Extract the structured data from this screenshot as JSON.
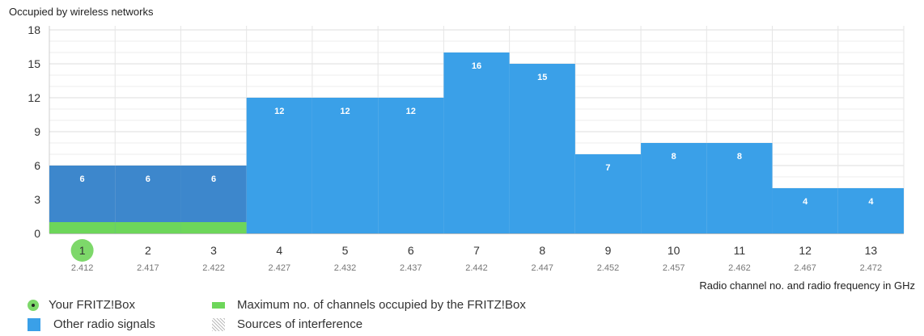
{
  "chart_data": {
    "type": "bar",
    "title": "Occupied by wireless networks",
    "xlabel": "Radio channel no. and radio frequency in GHz",
    "ylabel": "",
    "ylim": [
      0,
      18
    ],
    "yticks": [
      0,
      3,
      6,
      9,
      12,
      15,
      18
    ],
    "grid": true,
    "categories": [
      "1",
      "2",
      "3",
      "4",
      "5",
      "6",
      "7",
      "8",
      "9",
      "10",
      "11",
      "12",
      "13"
    ],
    "frequencies": [
      "2.412",
      "2.417",
      "2.422",
      "2.427",
      "2.432",
      "2.437",
      "2.442",
      "2.447",
      "2.452",
      "2.457",
      "2.462",
      "2.467",
      "2.472"
    ],
    "values": [
      6,
      6,
      6,
      12,
      12,
      12,
      16,
      15,
      7,
      8,
      8,
      4,
      4
    ],
    "fritzbox_channel": "1",
    "fritzbox_occupied_channels": [
      "1",
      "2",
      "3"
    ],
    "fritzbox_max_value": 1,
    "colors": {
      "other": "#3aa0e8",
      "fritzbox_range": "#3d87cc",
      "max_channels": "#6dd65a",
      "fritzbox_marker": "#7dd86a"
    }
  },
  "legend": {
    "your_fritzbox": "Your FRITZ!Box",
    "other_signals": "Other radio signals",
    "max_channels": "Maximum no. of channels occupied by the FRITZ!Box",
    "interference": "Sources of interference"
  }
}
